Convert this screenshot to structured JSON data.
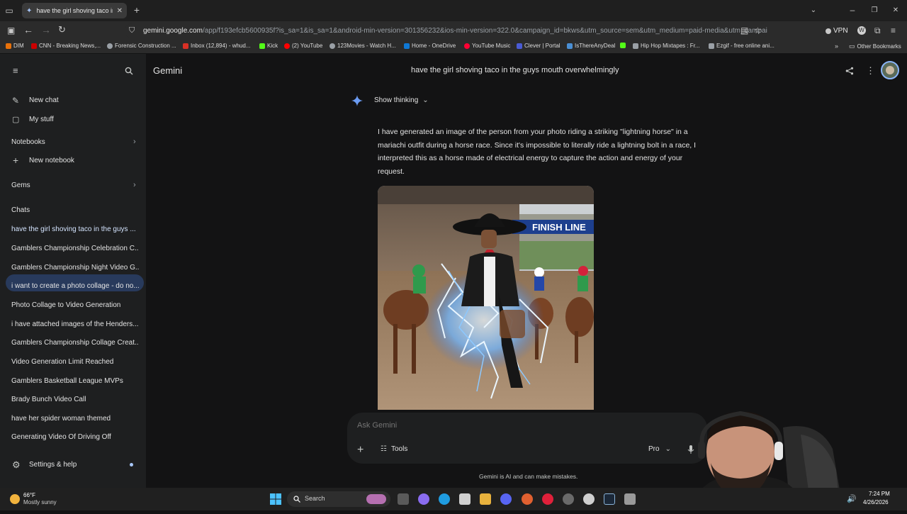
{
  "browser": {
    "tab_title": "have the girl shoving taco in the guys mouth overwhelmingly",
    "url_domain": "gemini.google.com",
    "url_path": "/app/f193efcb5600935f?is_sa=1&is_sa=1&android-min-version=301356232&ios-min-version=322.0&campaign_id=bkws&utm_source=sem&utm_medium=paid-media&utm_campai",
    "vpn_label": "VPN",
    "bookmarks": [
      {
        "label": "DIM",
        "color": "#e8710a"
      },
      {
        "label": "CNN - Breaking News,...",
        "color": "#cc0000"
      },
      {
        "label": "Forensic Construction ...",
        "color": "#9aa0a6"
      },
      {
        "label": "Inbox (12,894) - whud...",
        "color": "#d93025"
      },
      {
        "label": "Kick",
        "color": "#53fc18"
      },
      {
        "label": "(2) YouTube",
        "color": "#ff0000"
      },
      {
        "label": "123Movies - Watch H...",
        "color": "#9aa0a6"
      },
      {
        "label": "Home - OneDrive",
        "color": "#0f78d4"
      },
      {
        "label": "YouTube Music",
        "color": "#ff0033"
      },
      {
        "label": "Clever | Portal",
        "color": "#4a5bd4"
      },
      {
        "label": "IsThereAnyDeal",
        "color": "#4a8fd4"
      },
      {
        "label": "",
        "color": "#53fc18"
      },
      {
        "label": "Hip Hop Mixtapes : Fr...",
        "color": "#9aa0a6"
      },
      {
        "label": "Ezgif - free online ani...",
        "color": "#9aa0a6"
      }
    ],
    "other_bookmarks": "Other Bookmarks"
  },
  "sidebar": {
    "new_chat": "New chat",
    "my_stuff": "My stuff",
    "notebooks": "Notebooks",
    "new_notebook": "New notebook",
    "gems": "Gems",
    "chats_heading": "Chats",
    "chats": [
      "have the girl shoving taco in the guys ...",
      "Gamblers Championship Celebration C...",
      "Gamblers Championship Night Video G...",
      "i want to create a photo collage - do no...",
      "Photo Collage to Video Generation",
      "i have attached images of the Henders...",
      "Gamblers Championship Collage Creat...",
      "Video Generation Limit Reached",
      "Gamblers Basketball League MVPs",
      "Brady Bunch Video Call",
      "have her spider woman themed",
      "Generating Video Of Driving Off"
    ],
    "settings": "Settings & help"
  },
  "header": {
    "app_name": "Gemini",
    "conversation_title": "have the girl shoving taco in the guys mouth overwhelmingly"
  },
  "conversation": {
    "show_thinking": "Show thinking",
    "response_text": "I have generated an image of the person from your photo riding a striking \"lightning horse\" in a mariachi outfit during a horse race. Since it's impossible to literally ride a lightning bolt in a race, I interpreted this as a horse made of electrical energy to capture the action and energy of your request.",
    "image_sign": "FINISH LINE"
  },
  "input": {
    "placeholder": "Ask Gemini",
    "tools_label": "Tools",
    "mode_label": "Pro",
    "disclaimer": "Gemini is AI and can make mistakes."
  },
  "taskbar": {
    "weather_temp": "66°F",
    "weather_desc": "Mostly sunny",
    "search_label": "Search",
    "time": "7:24 PM",
    "date": "4/26/2026"
  },
  "colors": {
    "accent": "#a8c7fa",
    "active_chat_bg": "#283a5c",
    "sidebar_bg": "#1e1f20",
    "main_bg": "#131314"
  }
}
